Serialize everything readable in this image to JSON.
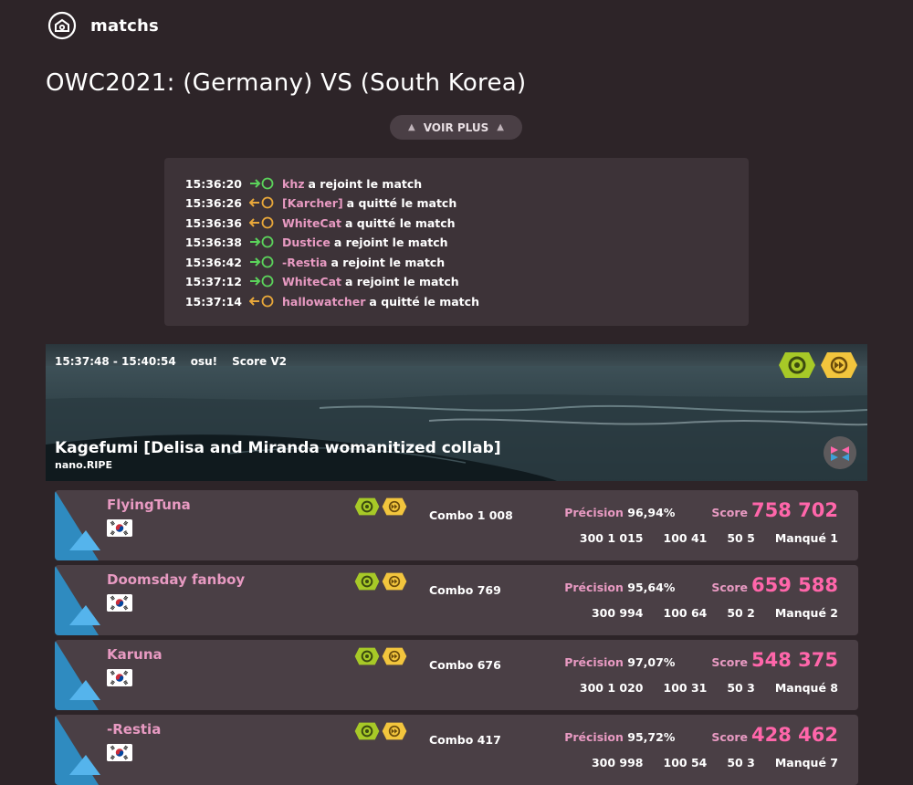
{
  "header": {
    "title": "matchs"
  },
  "match": {
    "title": "OWC2021: (Germany) VS (South Korea)"
  },
  "more_button": {
    "label": "VOIR PLUS"
  },
  "events": [
    {
      "time": "15:36:20",
      "type": "join",
      "user": "khz",
      "text": "a rejoint le match"
    },
    {
      "time": "15:36:26",
      "type": "leave",
      "user": "[Karcher]",
      "text": "a quitté le match"
    },
    {
      "time": "15:36:36",
      "type": "leave",
      "user": "WhiteCat",
      "text": "a quitté le match"
    },
    {
      "time": "15:36:38",
      "type": "join",
      "user": "Dustice",
      "text": "a rejoint le match"
    },
    {
      "time": "15:36:42",
      "type": "join",
      "user": "-Restia",
      "text": "a rejoint le match"
    },
    {
      "time": "15:37:12",
      "type": "join",
      "user": "WhiteCat",
      "text": "a rejoint le match"
    },
    {
      "time": "15:37:14",
      "type": "leave",
      "user": "hallowatcher",
      "text": "a quitté le match"
    }
  ],
  "game": {
    "time_range": "15:37:48 - 15:40:54",
    "mode": "osu!",
    "scoring": "Score V2",
    "beatmap_title": "Kagefumi [Delisa and Miranda womanitized collab]",
    "mapper": "nano.RIPE",
    "mods": [
      "no-fail-icon",
      "double-time-icon"
    ]
  },
  "scores": [
    {
      "player": "FlyingTuna",
      "country": "South Korea",
      "combo_label": "Combo",
      "combo": "1 008",
      "accuracy_label": "Précision",
      "accuracy": "96,94%",
      "score_label": "Score",
      "score": "758 702",
      "c300": "1 015",
      "c100": "41",
      "c50": "5",
      "miss_label": "Manqué",
      "miss": "1"
    },
    {
      "player": "Doomsday fanboy",
      "country": "South Korea",
      "combo_label": "Combo",
      "combo": "769",
      "accuracy_label": "Précision",
      "accuracy": "95,64%",
      "score_label": "Score",
      "score": "659 588",
      "c300": "994",
      "c100": "64",
      "c50": "2",
      "miss_label": "Manqué",
      "miss": "2"
    },
    {
      "player": "Karuna",
      "country": "South Korea",
      "combo_label": "Combo",
      "combo": "676",
      "accuracy_label": "Précision",
      "accuracy": "97,07%",
      "score_label": "Score",
      "score": "548 375",
      "c300": "1 020",
      "c100": "31",
      "c50": "3",
      "miss_label": "Manqué",
      "miss": "8"
    },
    {
      "player": "-Restia",
      "country": "South Korea",
      "combo_label": "Combo",
      "combo": "417",
      "accuracy_label": "Précision",
      "accuracy": "95,72%",
      "score_label": "Score",
      "score": "428 462",
      "c300": "998",
      "c100": "54",
      "c50": "3",
      "miss_label": "Manqué",
      "miss": "7"
    }
  ],
  "labels": {
    "c300": "300",
    "c100": "100",
    "c50": "50"
  },
  "colors": {
    "background": "#2d2428",
    "panel": "#4a3f45",
    "username": "#e89ac2",
    "score": "#ff66aa",
    "join": "#5bd35b",
    "leave": "#e8a73a",
    "team_blue": "#3ea0d8",
    "mod_nf": "#a7c927",
    "mod_dt": "#f2c53d"
  }
}
